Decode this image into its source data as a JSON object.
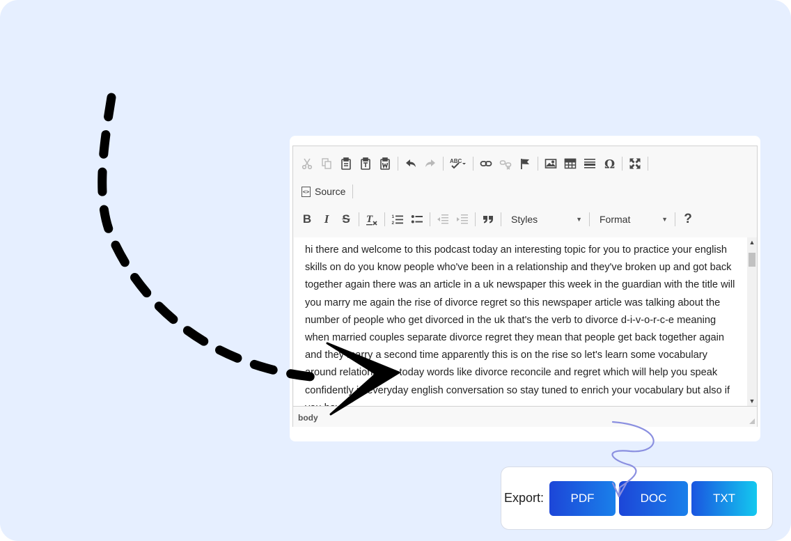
{
  "editor": {
    "toolbar_row1": [
      {
        "icon": "cut-icon",
        "enabled": false
      },
      {
        "icon": "copy-icon",
        "enabled": false
      },
      {
        "icon": "paste-icon",
        "enabled": true
      },
      {
        "icon": "paste-as-text-icon",
        "enabled": true
      },
      {
        "icon": "paste-from-word-icon",
        "enabled": true
      },
      {
        "icon": "undo-icon",
        "enabled": true
      },
      {
        "icon": "redo-icon",
        "enabled": false
      },
      {
        "icon": "spellcheck-icon",
        "enabled": true
      },
      {
        "icon": "link-icon",
        "enabled": true
      },
      {
        "icon": "unlink-icon",
        "enabled": false
      },
      {
        "icon": "anchor-flag-icon",
        "enabled": true
      },
      {
        "icon": "image-icon",
        "enabled": true
      },
      {
        "icon": "table-icon",
        "enabled": true
      },
      {
        "icon": "horizontal-line-icon",
        "enabled": true
      },
      {
        "icon": "special-char-omega-icon",
        "enabled": true
      },
      {
        "icon": "maximize-icon",
        "enabled": true
      }
    ],
    "source_label": "Source",
    "bold_label": "B",
    "italic_label": "I",
    "strike_label": "S",
    "styles_label": "Styles",
    "format_label": "Format",
    "help_label": "?",
    "content": "hi there and welcome to this podcast today an interesting topic for you to practice your english skills on do you know people who've been in a relationship and they've broken up and got back together again there was an article in a uk newspaper this week in the guardian with the title will you marry me again the rise of divorce regret so this newspaper article was talking about the number of people who get divorced in the uk that's the verb to divorce d-i-v-o-r-c-e meaning when married couples separate divorce regret they mean that people get back together again and they marry a second time apparently this is on the rise so let's learn some vocabulary around relationships today words like divorce reconcile and regret which will help you speak confidently in everyday english conversation so stay tuned to enrich your vocabulary but also if you have",
    "path_label": "body"
  },
  "export": {
    "label": "Export:",
    "buttons": [
      {
        "label": "PDF"
      },
      {
        "label": "DOC"
      },
      {
        "label": "TXT"
      }
    ]
  },
  "colors": {
    "background": "#e6efff",
    "button_gradient_start": "#1c46d8",
    "button_gradient_end": "#1a80ea",
    "arrow_stroke": "#000000",
    "squiggle_stroke": "#8a8fe0"
  }
}
